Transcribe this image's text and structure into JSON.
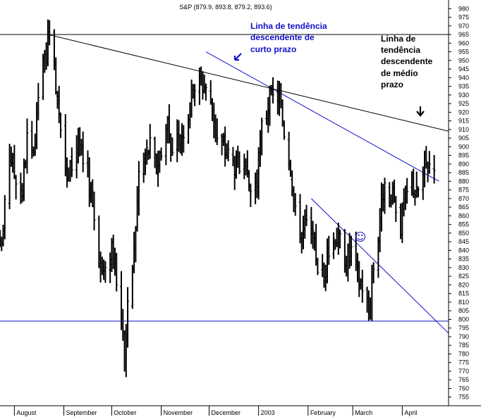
{
  "chart_data": {
    "type": "ohlc",
    "title": "S&P (879.9, 893.8, 879.2, 893.6)",
    "ylim": [
      750,
      985
    ],
    "yticks": [
      755,
      760,
      765,
      770,
      775,
      780,
      785,
      790,
      795,
      800,
      805,
      810,
      815,
      820,
      825,
      830,
      835,
      840,
      845,
      850,
      855,
      860,
      865,
      870,
      875,
      880,
      885,
      890,
      895,
      900,
      905,
      910,
      915,
      920,
      925,
      930,
      935,
      940,
      945,
      950,
      955,
      960,
      965,
      970,
      975,
      980
    ],
    "ytick_labels": [
      "755",
      "760",
      "765",
      "770",
      "775",
      "780",
      "785",
      "790",
      "795",
      "800",
      "805",
      "810",
      "815",
      "820",
      "825",
      "830",
      "835",
      "840",
      "845",
      "850",
      "855",
      "860",
      "865",
      "870",
      "875",
      "880",
      "885",
      "890",
      "895",
      "900",
      "905",
      "910",
      "915",
      "920",
      "925",
      "930",
      "935",
      "940",
      "945",
      "950",
      "955",
      "960",
      "965",
      "970",
      "975",
      "980"
    ],
    "x_period": [
      "2002-07-23",
      "2003-04-30"
    ],
    "month_labels": [
      {
        "label": "August",
        "date": "2002-08-01"
      },
      {
        "label": "September",
        "date": "2002-09-01"
      },
      {
        "label": "October",
        "date": "2002-10-01"
      },
      {
        "label": "November",
        "date": "2002-11-01"
      },
      {
        "label": "December",
        "date": "2002-12-01"
      },
      {
        "label": "2003",
        "date": "2003-01-01"
      },
      {
        "label": "February",
        "date": "2003-02-01"
      },
      {
        "label": "March",
        "date": "2003-03-01"
      },
      {
        "label": "April",
        "date": "2003-04-01"
      }
    ],
    "close_series": [
      [
        "2002-07-23",
        838
      ],
      [
        "2002-07-25",
        852
      ],
      [
        "2002-07-29",
        898
      ],
      [
        "2002-08-01",
        885
      ],
      [
        "2002-08-06",
        875
      ],
      [
        "2002-08-09",
        905
      ],
      [
        "2002-08-13",
        890
      ],
      [
        "2002-08-16",
        930
      ],
      [
        "2002-08-20",
        950
      ],
      [
        "2002-08-22",
        962
      ],
      [
        "2002-08-26",
        945
      ],
      [
        "2002-08-29",
        925
      ],
      [
        "2002-09-03",
        880
      ],
      [
        "2002-09-06",
        890
      ],
      [
        "2002-09-10",
        905
      ],
      [
        "2002-09-13",
        888
      ],
      [
        "2002-09-18",
        875
      ],
      [
        "2002-09-20",
        860
      ],
      [
        "2002-09-24",
        830
      ],
      [
        "2002-09-27",
        825
      ],
      [
        "2002-10-01",
        845
      ],
      [
        "2002-10-04",
        820
      ],
      [
        "2002-10-07",
        800
      ],
      [
        "2002-10-09",
        780
      ],
      [
        "2002-10-11",
        805
      ],
      [
        "2002-10-15",
        840
      ],
      [
        "2002-10-18",
        885
      ],
      [
        "2002-10-22",
        895
      ],
      [
        "2002-10-25",
        900
      ],
      [
        "2002-10-29",
        888
      ],
      [
        "2002-11-01",
        900
      ],
      [
        "2002-11-05",
        915
      ],
      [
        "2002-11-08",
        895
      ],
      [
        "2002-11-13",
        905
      ],
      [
        "2002-11-18",
        920
      ],
      [
        "2002-11-21",
        935
      ],
      [
        "2002-11-26",
        938
      ],
      [
        "2002-11-29",
        935
      ],
      [
        "2002-12-03",
        920
      ],
      [
        "2002-12-06",
        905
      ],
      [
        "2002-12-10",
        900
      ],
      [
        "2002-12-13",
        895
      ],
      [
        "2002-12-17",
        890
      ],
      [
        "2002-12-20",
        888
      ],
      [
        "2002-12-24",
        880
      ],
      [
        "2002-12-27",
        875
      ],
      [
        "2002-12-31",
        880
      ],
      [
        "2003-01-03",
        910
      ],
      [
        "2003-01-07",
        925
      ],
      [
        "2003-01-10",
        928
      ],
      [
        "2003-01-14",
        930
      ],
      [
        "2003-01-17",
        910
      ],
      [
        "2003-01-21",
        890
      ],
      [
        "2003-01-24",
        860
      ],
      [
        "2003-01-28",
        850
      ],
      [
        "2003-01-31",
        855
      ],
      [
        "2003-02-04",
        845
      ],
      [
        "2003-02-07",
        832
      ],
      [
        "2003-02-11",
        825
      ],
      [
        "2003-02-14",
        840
      ],
      [
        "2003-02-18",
        850
      ],
      [
        "2003-02-21",
        845
      ],
      [
        "2003-02-25",
        835
      ],
      [
        "2003-02-28",
        840
      ],
      [
        "2003-03-04",
        825
      ],
      [
        "2003-03-07",
        820
      ],
      [
        "2003-03-11",
        805
      ],
      [
        "2003-03-13",
        825
      ],
      [
        "2003-03-17",
        850
      ],
      [
        "2003-03-20",
        875
      ],
      [
        "2003-03-24",
        865
      ],
      [
        "2003-03-27",
        870
      ],
      [
        "2003-03-31",
        855
      ],
      [
        "2003-04-03",
        870
      ],
      [
        "2003-04-07",
        880
      ],
      [
        "2003-04-10",
        872
      ],
      [
        "2003-04-14",
        885
      ],
      [
        "2003-04-17",
        890
      ],
      [
        "2003-04-21",
        893
      ]
    ],
    "trendlines": [
      {
        "name": "Linha de tendência descendente de médio prazo",
        "color": "#000000",
        "points": [
          [
            "2002-08-22",
            965
          ],
          [
            "2003-04-30",
            909
          ]
        ]
      },
      {
        "name": "Linha de tendência descendente de curto prazo",
        "color": "#1010c8",
        "points": [
          [
            "2002-11-29",
            955
          ],
          [
            "2003-04-24",
            880
          ]
        ]
      },
      {
        "name": "canal inferior",
        "color": "#1010c8",
        "points": [
          [
            "2003-02-03",
            870
          ],
          [
            "2003-04-30",
            792
          ]
        ]
      },
      {
        "name": "suporte horizontal",
        "color": "#1010c8",
        "points": [
          [
            "2002-07-23",
            799
          ],
          [
            "2003-04-30",
            799
          ]
        ]
      },
      {
        "name": "resistência horizontal",
        "color": "#000000",
        "points": [
          [
            "2002-07-23",
            965
          ],
          [
            "2003-04-30",
            965
          ]
        ]
      }
    ]
  },
  "annotations": {
    "short_term": [
      "Linha de tendência",
      "descendente de",
      "curto prazo"
    ],
    "medium_term": [
      "Linha de",
      "tendência",
      "descendente",
      "de médio",
      "prazo"
    ],
    "smiley": "☺"
  },
  "colors": {
    "bars": "#000000",
    "blue_lines": "#1010c8",
    "blue_text": "#1010c8",
    "black_lines": "#000000"
  }
}
